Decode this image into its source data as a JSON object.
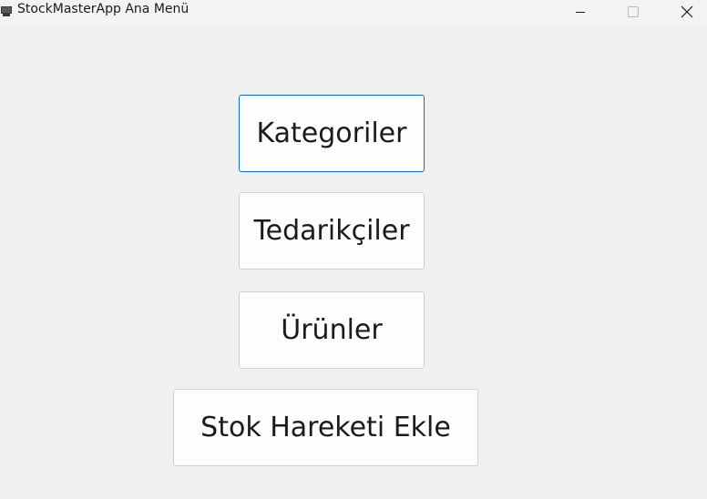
{
  "window": {
    "title": "StockMasterApp Ana Menü",
    "icon": "app-window-icon",
    "controls": {
      "minimize_icon": "minimize-icon",
      "maximize_icon": "maximize-icon",
      "close_icon": "close-icon"
    }
  },
  "menu": {
    "buttons": [
      {
        "label": "Kategoriler",
        "focused": true
      },
      {
        "label": "Tedarikçiler",
        "focused": false
      },
      {
        "label": "Ürünler",
        "focused": false
      },
      {
        "label": "Stok Hareketi Ekle",
        "focused": false
      }
    ]
  },
  "colors": {
    "background": "#f0f0f0",
    "button_background": "#fdfdfd",
    "button_border": "#d0d0d0",
    "focus_border": "#0f6cbd"
  }
}
